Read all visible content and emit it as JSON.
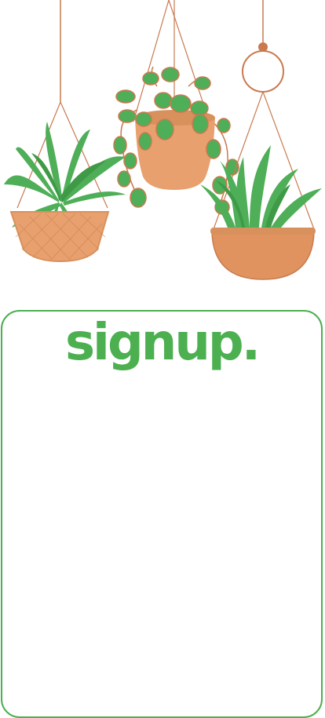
{
  "app": {
    "title": "signup.",
    "brand_color": "#4caf50"
  },
  "hero": {
    "illustration": "hanging-plants-illustration",
    "colors": {
      "pot": "#e7a06e",
      "pot_dark": "#d8915c",
      "leaf": "#4fae58",
      "leaf_dark": "#3f9a47",
      "rope": "#c97a4f"
    }
  }
}
